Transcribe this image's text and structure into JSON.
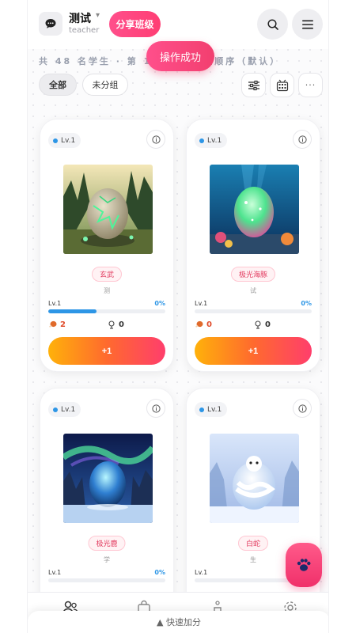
{
  "header": {
    "class_name": "测试",
    "class_subtitle": "teacher",
    "share_label": "分享班级"
  },
  "info": {
    "summary": "共 48 名学生 · 第 1/",
    "sort": "座位顺序（默认）"
  },
  "toast": "操作成功",
  "filters": [
    {
      "label": "全部",
      "active": true
    },
    {
      "label": "未分组",
      "active": false
    }
  ],
  "more_label": "···",
  "cards": [
    {
      "level": "Lv.1",
      "pet": "玄武",
      "student": "测",
      "level_label": "Lv.1",
      "progress": "0%",
      "food": "2",
      "trophy": "0",
      "button": "+1",
      "theme": "forest-egg"
    },
    {
      "level": "Lv.1",
      "pet": "极光海豚",
      "student": "试",
      "level_label": "Lv.1",
      "progress": "0%",
      "food": "0",
      "trophy": "0",
      "button": "+1",
      "theme": "ocean-egg"
    },
    {
      "level": "Lv.1",
      "pet": "极光鹿",
      "student": "学",
      "level_label": "Lv.1",
      "progress": "0%",
      "food": "",
      "trophy": "",
      "button": "",
      "theme": "aurora-egg"
    },
    {
      "level": "Lv.1",
      "pet": "白蛇",
      "student": "生",
      "level_label": "Lv.1",
      "progress": "0%",
      "food": "",
      "trophy": "",
      "button": "",
      "theme": "snow-egg"
    }
  ],
  "progress_fraction": [
    0.41,
    0.0,
    0.0,
    0.0
  ],
  "bottom_nav": [
    "people-icon",
    "shop-bag-icon",
    "rank-icon",
    "settings-gear-icon"
  ],
  "quick_add": "▲ 快速加分",
  "colors": {
    "accent": "#ff4f8b",
    "level_blue": "#2d96e6",
    "food_red": "#e04c2b"
  }
}
